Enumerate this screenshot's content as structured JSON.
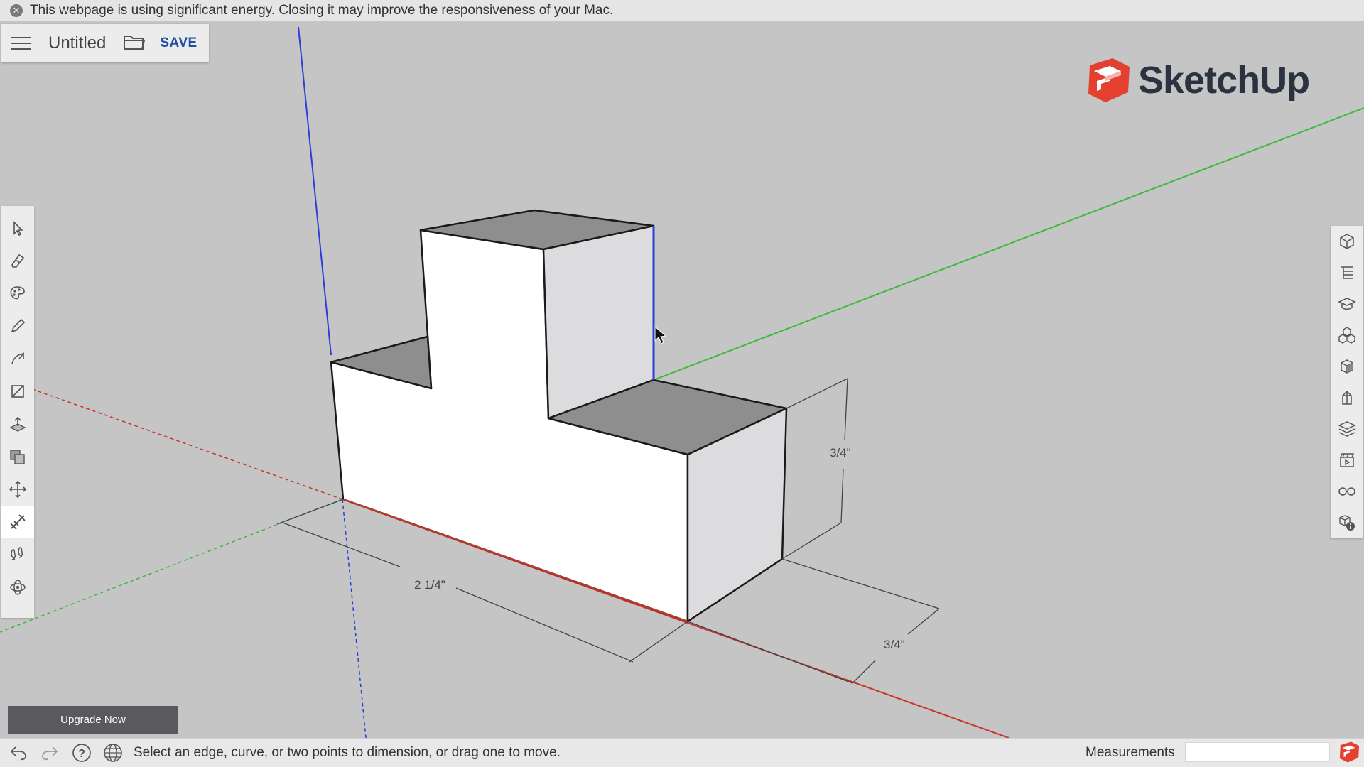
{
  "banner": {
    "message": "This webpage is using significant energy. Closing it may improve the responsiveness of your Mac.",
    "close_icon": "close-circle-icon"
  },
  "titlebar": {
    "menu_icon": "hamburger-menu-icon",
    "document_title": "Untitled",
    "folder_icon": "folder-icon",
    "save_label": "SAVE"
  },
  "logo": {
    "text": "SketchUp",
    "brand_color": "#e4402f"
  },
  "left_toolbar": {
    "tools": [
      {
        "name": "select-tool",
        "icon": "arrow-icon"
      },
      {
        "name": "eraser-tool",
        "icon": "eraser-icon"
      },
      {
        "name": "paint-bucket-tool",
        "icon": "palette-icon"
      },
      {
        "name": "line-tool",
        "icon": "pencil-icon"
      },
      {
        "name": "arc-tool",
        "icon": "arc-icon"
      },
      {
        "name": "rectangle-tool",
        "icon": "rectangle-icon"
      },
      {
        "name": "push-pull-tool",
        "icon": "push-pull-icon"
      },
      {
        "name": "offset-tool",
        "icon": "offset-icon"
      },
      {
        "name": "move-tool",
        "icon": "move-icon"
      },
      {
        "name": "dimension-tool",
        "icon": "dimension-icon",
        "active": true
      },
      {
        "name": "walk-tool",
        "icon": "footprints-icon"
      },
      {
        "name": "orbit-tool",
        "icon": "orbit-icon"
      }
    ]
  },
  "right_toolbar": {
    "panels": [
      "entity-info-icon",
      "outliner-icon",
      "instructor-icon",
      "components-icon",
      "materials-icon",
      "styles-icon",
      "layers-icon",
      "scenes-icon",
      "display-icon",
      "model-info-icon"
    ]
  },
  "model": {
    "dimensions": {
      "length": "2 1/4\"",
      "height": "3/4\"",
      "depth": "3/4\""
    },
    "colors": {
      "red_axis": "#c8342a",
      "green_axis": "#3fb93a",
      "blue_axis": "#2a3fd6",
      "top_face": "#8e8e8e",
      "side_face": "#dcdcdf",
      "front_face": "#ffffff"
    }
  },
  "upgrade": {
    "label": "Upgrade Now"
  },
  "statusbar": {
    "hint": "Select an edge, curve, or two points to dimension, or drag one to move.",
    "measurements_label": "Measurements",
    "icons": [
      "undo-icon",
      "redo-icon",
      "help-icon",
      "globe-icon"
    ]
  }
}
